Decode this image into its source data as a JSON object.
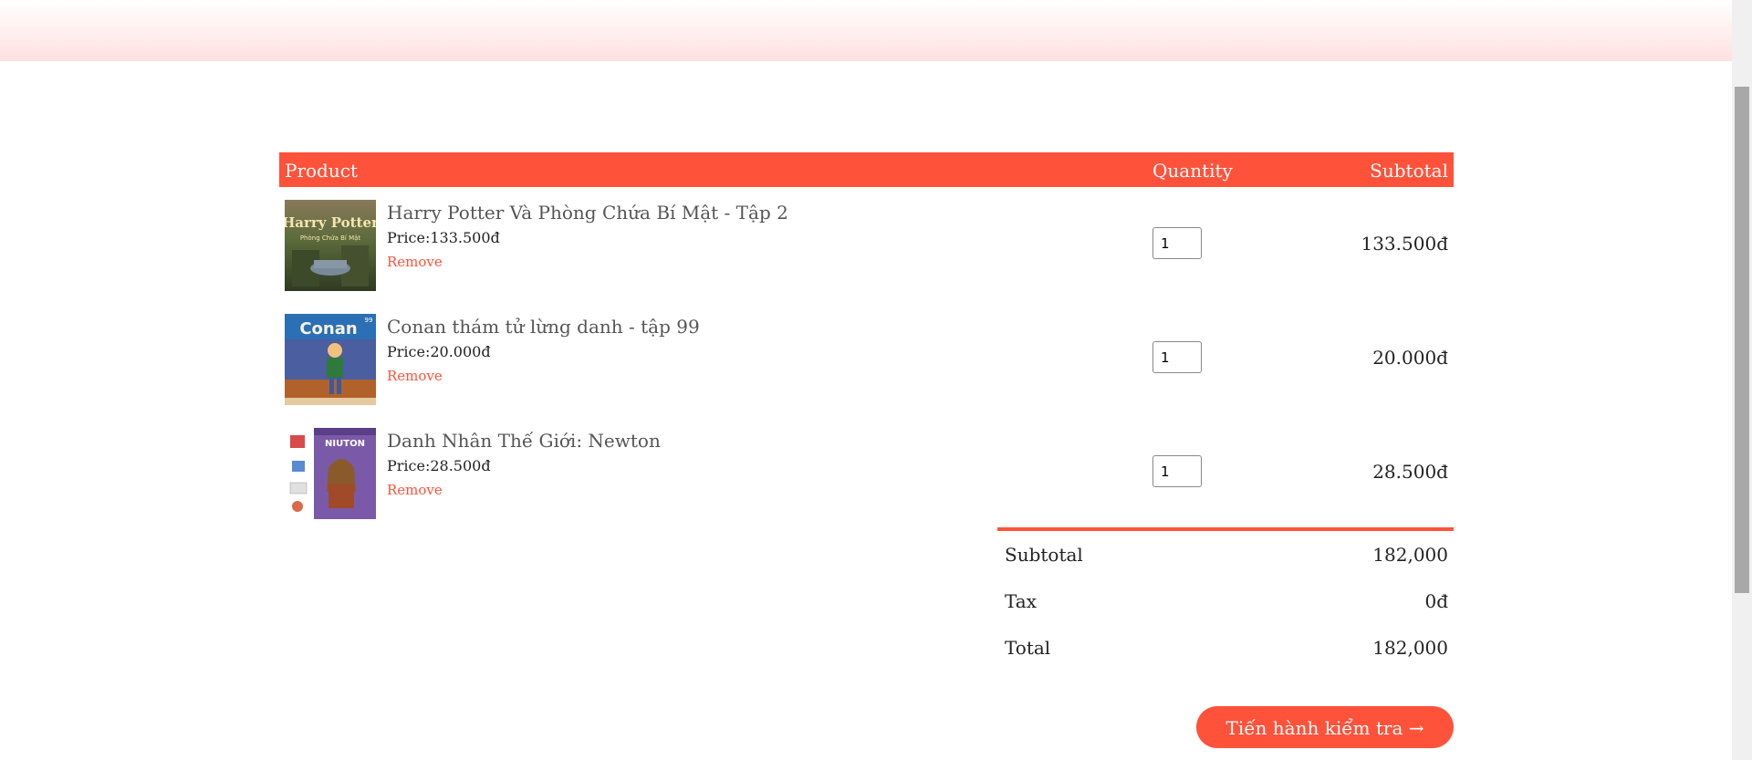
{
  "cart": {
    "headers": {
      "product": "Product",
      "quantity": "Quantity",
      "subtotal": "Subtotal"
    },
    "items": [
      {
        "title": "Harry Potter Và Phòng Chứa Bí Mật - Tập 2",
        "price": "Price:133.500đ",
        "remove": "Remove",
        "quantity": "1",
        "subtotal": "133.500đ",
        "cover_text": "Harry Potter",
        "cover_sub": "Phòng Chứa Bí Mật"
      },
      {
        "title": "Conan thám tử lừng danh - tập 99",
        "price": "Price:20.000đ",
        "remove": "Remove",
        "quantity": "1",
        "subtotal": "20.000đ",
        "cover_text": "Conan",
        "cover_sub": "99"
      },
      {
        "title": "Danh Nhân Thế Giới: Newton",
        "price": "Price:28.500đ",
        "remove": "Remove",
        "quantity": "1",
        "subtotal": "28.500đ",
        "cover_text": "NIUTON",
        "cover_sub": ""
      }
    ]
  },
  "totals": {
    "subtotal_label": "Subtotal",
    "subtotal_value": "182,000",
    "tax_label": "Tax",
    "tax_value": "0đ",
    "total_label": "Total",
    "total_value": "182,000"
  },
  "checkout": {
    "label": "Tiến hành kiểm tra →"
  },
  "colors": {
    "accent": "#ff523b",
    "header_band": "#ffe0e0"
  }
}
